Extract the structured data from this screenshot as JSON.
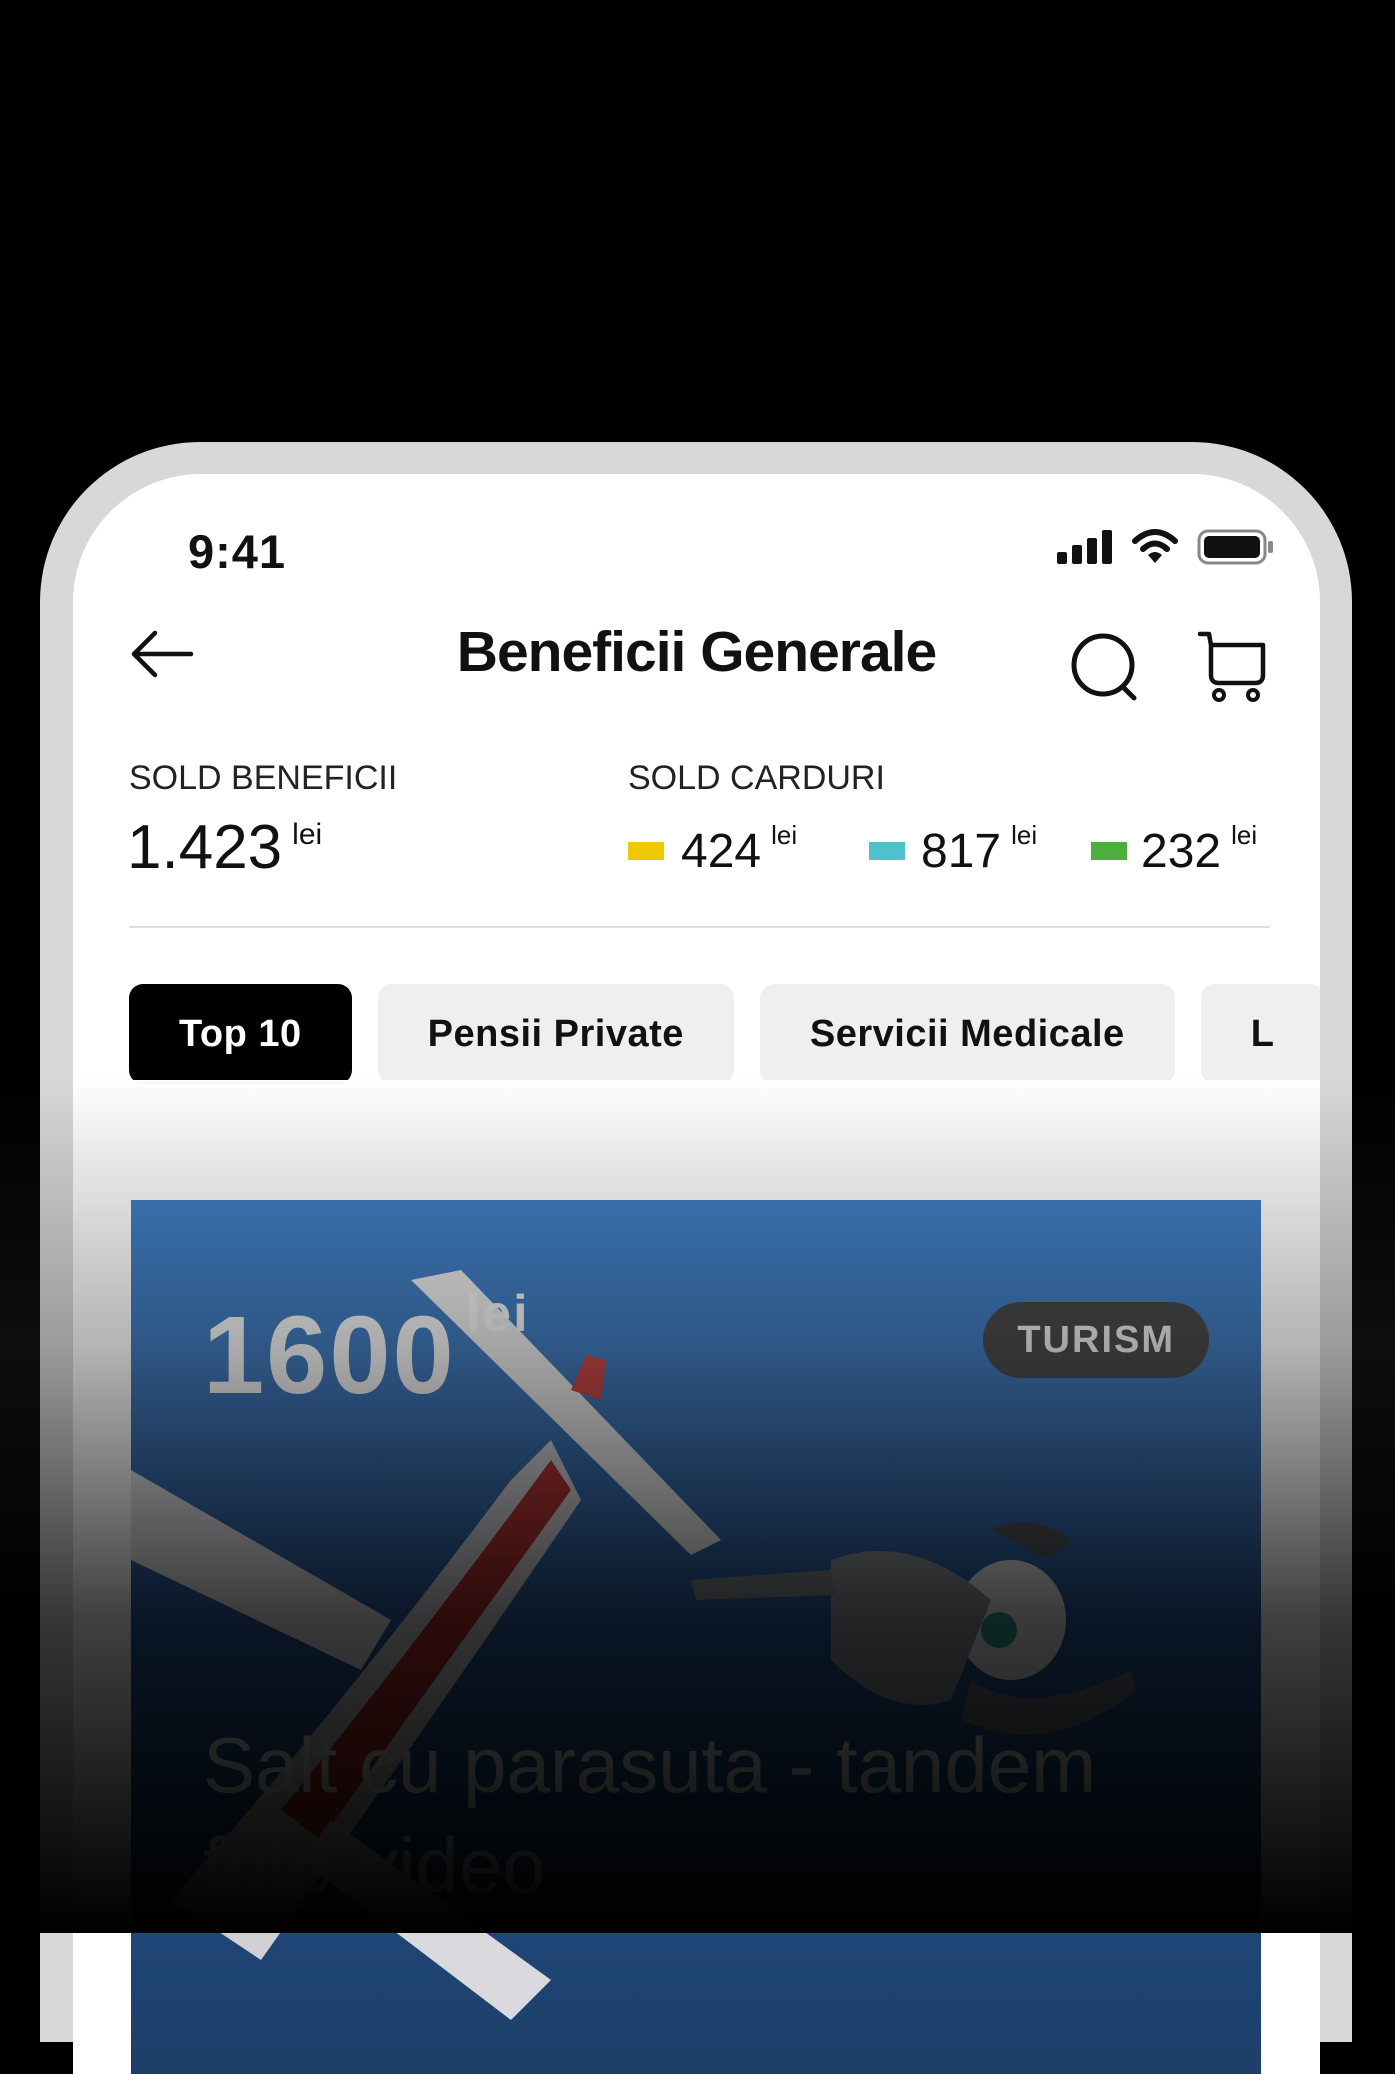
{
  "status_bar": {
    "time": "9:41"
  },
  "header": {
    "title": "Beneficii Generale"
  },
  "balances": {
    "benefits_label": "SOLD BENEFICII",
    "benefits_amount": "1.423",
    "benefits_unit": "lei",
    "cards_label": "SOLD CARDURI",
    "cards": [
      {
        "amount": "424",
        "unit": "lei",
        "color": "#f0c800"
      },
      {
        "amount": "817",
        "unit": "lei",
        "color": "#4fc0cc"
      },
      {
        "amount": "232",
        "unit": "lei",
        "color": "#4cae3c"
      }
    ]
  },
  "categories": [
    {
      "label": "Top 10",
      "active": true
    },
    {
      "label": "Pensii Private",
      "active": false
    },
    {
      "label": "Servicii Medicale",
      "active": false
    },
    {
      "label": "L",
      "active": false
    }
  ],
  "featured": {
    "price": "1600",
    "unit": "lei",
    "tag": "TURISM",
    "title": "Salt cu parasuta - tandem foto-video"
  },
  "colors": {
    "accent": "#000000",
    "chip_bg": "#efefef",
    "tag_bg": "#3c3c3c"
  }
}
